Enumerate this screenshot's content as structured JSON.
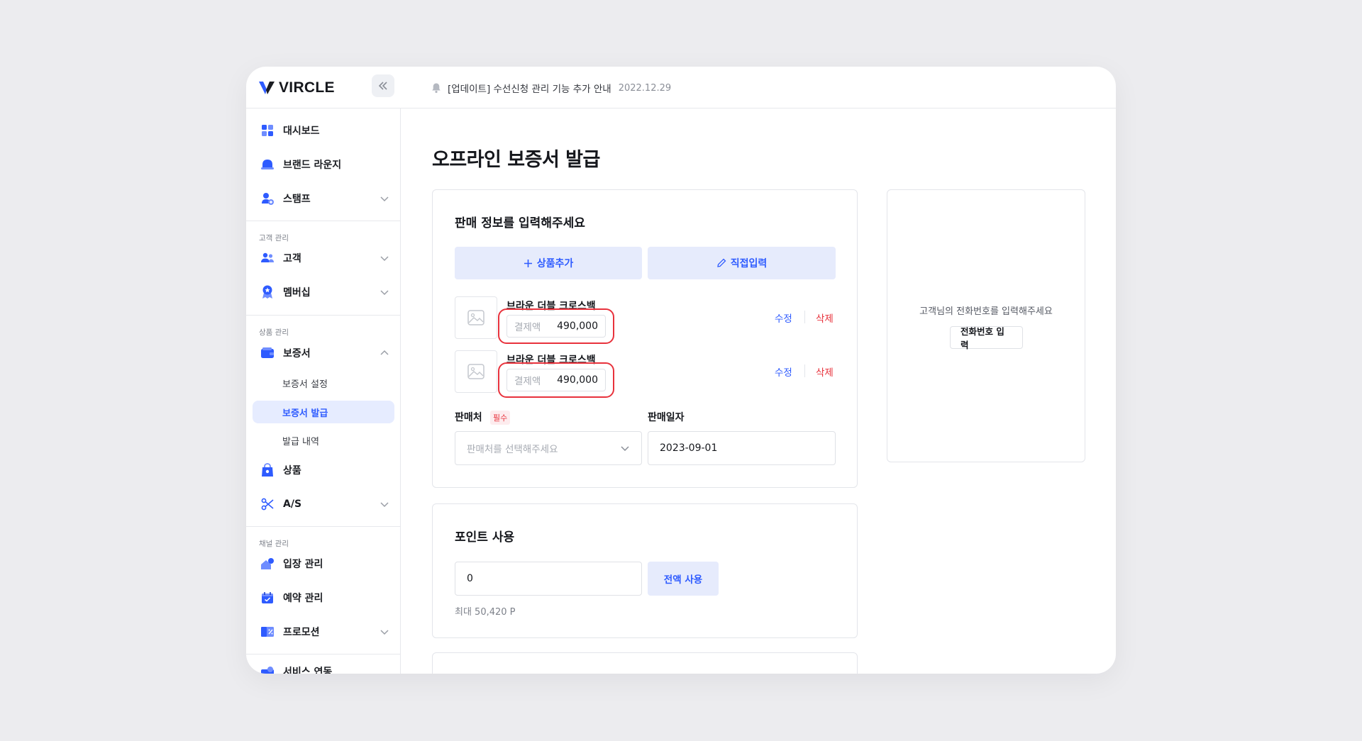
{
  "app": {
    "brand": "VIRCLE"
  },
  "header": {
    "notice": "[업데이트] 수선신청 관리 기능 추가 안내",
    "notice_date": "2022.12.29"
  },
  "sidebar": {
    "items": [
      {
        "label": "대시보드",
        "icon": "dashboard-icon"
      },
      {
        "label": "브랜드 라운지",
        "icon": "lounge-icon"
      },
      {
        "label": "스탬프",
        "icon": "stamp-icon"
      }
    ],
    "section_customer": "고객 관리",
    "customer_items": [
      {
        "label": "고객",
        "icon": "users-icon"
      },
      {
        "label": "멤버십",
        "icon": "membership-icon"
      }
    ],
    "section_product": "상품 관리",
    "product_items": [
      {
        "label": "보증서",
        "icon": "wallet-icon"
      }
    ],
    "warranty_sub": [
      {
        "label": "보증서 설정"
      },
      {
        "label": "보증서 발급"
      },
      {
        "label": "발급 내역"
      }
    ],
    "product_items2": [
      {
        "label": "상품",
        "icon": "bag-icon"
      },
      {
        "label": "A/S",
        "icon": "scissors-icon"
      }
    ],
    "section_channel": "채널 관리",
    "channel_items": [
      {
        "label": "입장 관리",
        "icon": "entry-icon"
      },
      {
        "label": "예약 관리",
        "icon": "calendar-icon"
      },
      {
        "label": "프로모션",
        "icon": "promotion-icon"
      },
      {
        "label": "서비스 연동",
        "icon": "service-icon"
      }
    ]
  },
  "main": {
    "title": "오프라인 보증서 발급",
    "sales": {
      "title": "판매 정보를 입력해주세요",
      "add_product": "상품추가",
      "direct_input": "직접입력",
      "products": [
        {
          "name": "브라운 더블 크로스백",
          "price_placeholder": "결제액",
          "price": "490,000",
          "edit": "수정",
          "delete": "삭제"
        },
        {
          "name": "브라운 더블 크로스백",
          "price_placeholder": "결제액",
          "price": "490,000",
          "edit": "수정",
          "delete": "삭제"
        }
      ],
      "seller_label": "판매처",
      "required": "필수",
      "seller_placeholder": "판매처를 선택해주세요",
      "date_label": "판매일자",
      "date_value": "2023-09-01"
    },
    "points": {
      "title": "포인트 사용",
      "value": "0",
      "use_all": "전액 사용",
      "max": "최대 50,420 P"
    },
    "customer": {
      "message": "고객님의 전화번호를 입력해주세요",
      "button": "전화번호 입력"
    }
  },
  "colors": {
    "accent": "#2e5bff",
    "soft_accent": "#e6ebfc",
    "danger": "#e8323c",
    "background": "#ececef"
  }
}
